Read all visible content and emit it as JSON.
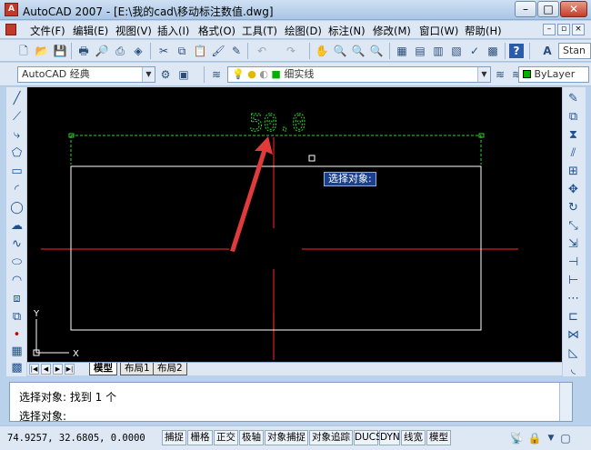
{
  "window": {
    "title": "AutoCAD 2007 - [E:\\我的cad\\移动标注数值.dwg]",
    "logo": "A",
    "minimize": "–",
    "maximize": "□",
    "close": "✕"
  },
  "menu": [
    "文件(F)",
    "编辑(E)",
    "视图(V)",
    "插入(I)",
    "格式(O)",
    "工具(T)",
    "绘图(D)",
    "标注(N)",
    "修改(M)",
    "窗口(W)",
    "帮助(H)"
  ],
  "mdi": {
    "min": "–",
    "restore": "▫",
    "close": "×"
  },
  "toolbar": {
    "text_style": "Stan",
    "workspace": "AutoCAD 经典",
    "layer": "细实线",
    "color": "ByLayer",
    "color_value": "#00b000"
  },
  "canvas": {
    "dimension_text": "50.0",
    "tooltip": "选择对象:",
    "ucs_x": "X",
    "ucs_y": "Y",
    "colors": {
      "dimension": "#2bd12b",
      "centerline": "#d42020",
      "arrow": "#e03a3a",
      "tooltip_bg": "#1a3f8c"
    }
  },
  "tabs": [
    "模型",
    "布局1",
    "布局2"
  ],
  "command": {
    "line1": "选择对象: 找到 1 个",
    "line2": "选择对象:"
  },
  "status": {
    "coords": "74.9257,  32.6805, 0.0000",
    "buttons": [
      "捕捉",
      "栅格",
      "正交",
      "极轴",
      "对象捕捉",
      "对象追踪",
      "DUCS",
      "DYN",
      "线宽",
      "模型"
    ]
  }
}
